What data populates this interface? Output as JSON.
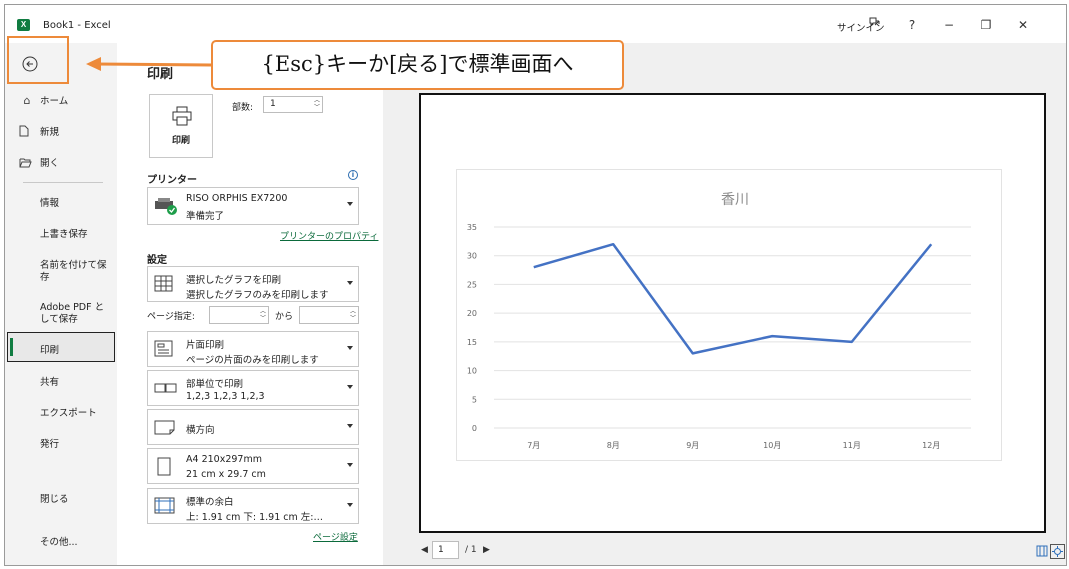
{
  "window": {
    "app_icon_letter": "X",
    "title": "Book1  -  Excel",
    "signin": "サインイン",
    "controls": [
      "?",
      "−",
      "❐",
      "✕"
    ]
  },
  "callout": {
    "text": "{Esc}キーか[戻る]で標準画面へ",
    "color": "#ed8a3a"
  },
  "nav": {
    "items": [
      {
        "label": "ホーム",
        "icon": "home-icon"
      },
      {
        "label": "新規",
        "icon": "new-document-icon"
      },
      {
        "label": "開く",
        "icon": "folder-open-icon"
      },
      {
        "label": "情報"
      },
      {
        "label": "上書き保存"
      },
      {
        "label": "名前を付けて保存"
      },
      {
        "label": "Adobe PDF として保存"
      },
      {
        "label": "印刷",
        "active": true
      },
      {
        "label": "共有"
      },
      {
        "label": "エクスポート"
      },
      {
        "label": "発行"
      },
      {
        "label": "閉じる"
      },
      {
        "label": "その他..."
      }
    ]
  },
  "print": {
    "title": "印刷",
    "print_button": "印刷",
    "copies_label": "部数:",
    "copies_value": "1",
    "printer_section": "プリンター",
    "printer_name": "RISO ORPHIS EX7200",
    "printer_status": "準備完了",
    "printer_properties": "プリンターのプロパティ",
    "settings_section": "設定",
    "settings": [
      {
        "line1": "選択したグラフを印刷",
        "line2": "選択したグラフのみを印刷します",
        "icon": "grid-icon"
      },
      {
        "line1": "片面印刷",
        "line2": "ページの片面のみを印刷します",
        "icon": "single-sided-icon"
      },
      {
        "line1": "部単位で印刷",
        "line2": "1,2,3    1,2,3    1,2,3",
        "icon": "collate-icon"
      },
      {
        "line1": "横方向",
        "icon": "landscape-icon"
      },
      {
        "line1": "A4 210x297mm",
        "line2": "21 cm x 29.7 cm",
        "icon": "paper-size-icon"
      },
      {
        "line1": "標準の余白",
        "line2": "上: 1.91 cm 下: 1.91 cm 左:…",
        "icon": "margins-icon"
      }
    ],
    "pages_label": "ページ指定:",
    "pages_to": "から",
    "page_setup": "ページ設定"
  },
  "preview": {
    "current_page": "1",
    "total_pages": "/ 1"
  },
  "chart_data": {
    "type": "line",
    "title": "香川",
    "categories": [
      "7月",
      "8月",
      "9月",
      "10月",
      "11月",
      "12月"
    ],
    "series": [
      {
        "values": [
          28,
          32,
          13,
          16,
          15,
          32
        ],
        "color": "#4472c4"
      }
    ],
    "ylim": [
      0,
      35
    ],
    "yticks": [
      0,
      5,
      10,
      15,
      20,
      25,
      30,
      35
    ],
    "grid": true,
    "xlabel": "",
    "ylabel": ""
  }
}
